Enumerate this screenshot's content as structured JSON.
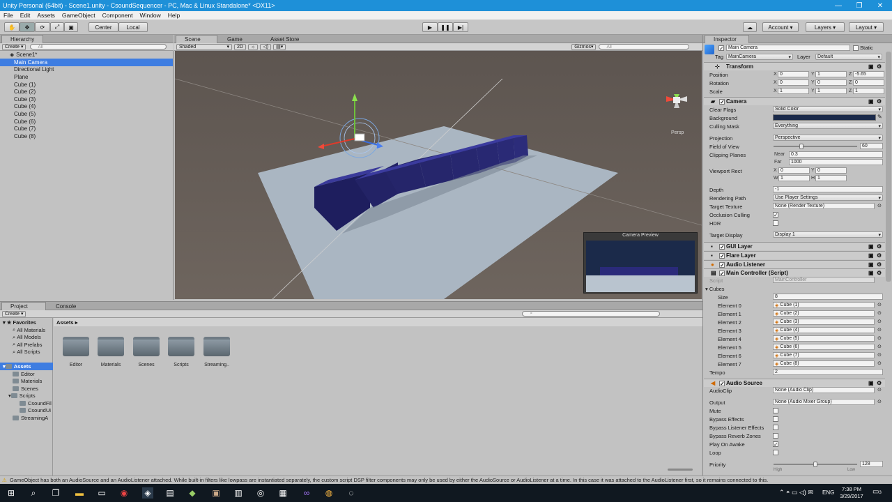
{
  "window": {
    "title": "Unity Personal (64bit) - Scene1.unity - CsoundSequencer - PC, Mac & Linux Standalone* <DX11>"
  },
  "menu": [
    "File",
    "Edit",
    "Assets",
    "GameObject",
    "Component",
    "Window",
    "Help"
  ],
  "toolbar": {
    "center": "Center",
    "local": "Local",
    "account": "Account",
    "layers": "Layers",
    "layout": "Layout"
  },
  "hierarchy": {
    "tab": "Hierarchy",
    "create": "Create",
    "search_placeholder": "All",
    "scene": "Scene1*",
    "items": [
      "Main Camera",
      "Directional Light",
      "Plane",
      "Cube (1)",
      "Cube (2)",
      "Cube (3)",
      "Cube (4)",
      "Cube (5)",
      "Cube (6)",
      "Cube (7)",
      "Cube (8)"
    ],
    "selected": "Main Camera"
  },
  "scene_view": {
    "tabs": [
      "Scene",
      "Game",
      "Asset Store"
    ],
    "shading": "Shaded",
    "mode_2d": "2D",
    "gizmos": "Gizmos",
    "search_placeholder": "All",
    "persp": "Persp",
    "camera_preview": "Camera Preview"
  },
  "project": {
    "tabs": [
      "Project",
      "Console"
    ],
    "create": "Create",
    "favorites": "Favorites",
    "favorites_items": [
      "All Materials",
      "All Models",
      "All Prefabs",
      "All Scripts"
    ],
    "assets_root": "Assets",
    "tree": [
      "Editor",
      "Materials",
      "Scenes",
      "Scripts",
      "CsoundFil",
      "CsoundUi",
      "StreamingA"
    ],
    "breadcrumb": "Assets",
    "folders": [
      "Editor",
      "Materials",
      "Scenes",
      "Scripts",
      "Streaming.."
    ]
  },
  "inspector": {
    "tab": "Inspector",
    "object_name": "Main Camera",
    "static": "Static",
    "tag_label": "Tag",
    "tag": "MainCamera",
    "layer_label": "Layer",
    "layer": "Default",
    "transform": {
      "title": "Transform",
      "position": {
        "label": "Position",
        "x": "0",
        "y": "1",
        "z": "-5.65"
      },
      "rotation": {
        "label": "Rotation",
        "x": "0",
        "y": "0",
        "z": "0"
      },
      "scale": {
        "label": "Scale",
        "x": "1",
        "y": "1",
        "z": "1"
      }
    },
    "camera": {
      "title": "Camera",
      "clear_flags": {
        "label": "Clear Flags",
        "value": "Solid Color"
      },
      "background": {
        "label": "Background",
        "color": "#1b2a4a"
      },
      "culling_mask": {
        "label": "Culling Mask",
        "value": "Everything"
      },
      "projection": {
        "label": "Projection",
        "value": "Perspective"
      },
      "fov": {
        "label": "Field of View",
        "value": "60",
        "fraction": 0.33
      },
      "clipping": {
        "label": "Clipping Planes",
        "near_label": "Near",
        "near": "0.3",
        "far_label": "Far",
        "far": "1000"
      },
      "viewport": {
        "label": "Viewport Rect",
        "x": "0",
        "y": "0",
        "w": "1",
        "h": "1"
      },
      "depth": {
        "label": "Depth",
        "value": "-1"
      },
      "rendering_path": {
        "label": "Rendering Path",
        "value": "Use Player Settings"
      },
      "target_texture": {
        "label": "Target Texture",
        "value": "None (Render Texture)"
      },
      "occlusion": {
        "label": "Occlusion Culling",
        "checked": true
      },
      "hdr": {
        "label": "HDR",
        "checked": false
      },
      "target_display": {
        "label": "Target Display",
        "value": "Display 1"
      }
    },
    "gui_layer": "GUI Layer",
    "flare_layer": "Flare Layer",
    "audio_listener": "Audio Listener",
    "main_controller": {
      "title": "Main Controller (Script)",
      "script_label": "Script",
      "script": "MainController",
      "cubes_label": "Cubes",
      "size_label": "Size",
      "size": "8",
      "elements": [
        {
          "label": "Element 0",
          "value": "Cube (1)"
        },
        {
          "label": "Element 1",
          "value": "Cube (2)"
        },
        {
          "label": "Element 2",
          "value": "Cube (3)"
        },
        {
          "label": "Element 3",
          "value": "Cube (4)"
        },
        {
          "label": "Element 4",
          "value": "Cube (5)"
        },
        {
          "label": "Element 5",
          "value": "Cube (6)"
        },
        {
          "label": "Element 6",
          "value": "Cube (7)"
        },
        {
          "label": "Element 7",
          "value": "Cube (8)"
        }
      ],
      "tempo_label": "Tempo",
      "tempo": "2"
    },
    "audio_source": {
      "title": "Audio Source",
      "audioclip": {
        "label": "AudioClip",
        "value": "None (Audio Clip)"
      },
      "output": {
        "label": "Output",
        "value": "None (Audio Mixer Group)"
      },
      "mute": {
        "label": "Mute",
        "checked": false
      },
      "bypass_effects": {
        "label": "Bypass Effects",
        "checked": false
      },
      "bypass_listener": {
        "label": "Bypass Listener Effects",
        "checked": false
      },
      "bypass_reverb": {
        "label": "Bypass Reverb Zones",
        "checked": false
      },
      "play_on_awake": {
        "label": "Play On Awake",
        "checked": true
      },
      "loop": {
        "label": "Loop",
        "checked": false
      },
      "priority": {
        "label": "Priority",
        "value": "128",
        "high": "High",
        "low": "Low",
        "fraction": 0.5
      }
    }
  },
  "status": "GameObject has both an AudioSource and an AudioListener attached. While built-in filters like lowpass are instantiated separately, the custom script DSP filter components may only be used by either the AudioSource or AudioListener at a time. In this case it was attached to the AudioListener first, so it remains connected to this.",
  "taskbar": {
    "time": "7:38 PM",
    "date": "3/29/2017",
    "lang": "ENG",
    "notifications": "3"
  },
  "colors": {
    "selection": "#3e7de1",
    "cube": "#2a2a7a",
    "sky": "#6a5f57",
    "titlebar": "#1e90d8"
  }
}
